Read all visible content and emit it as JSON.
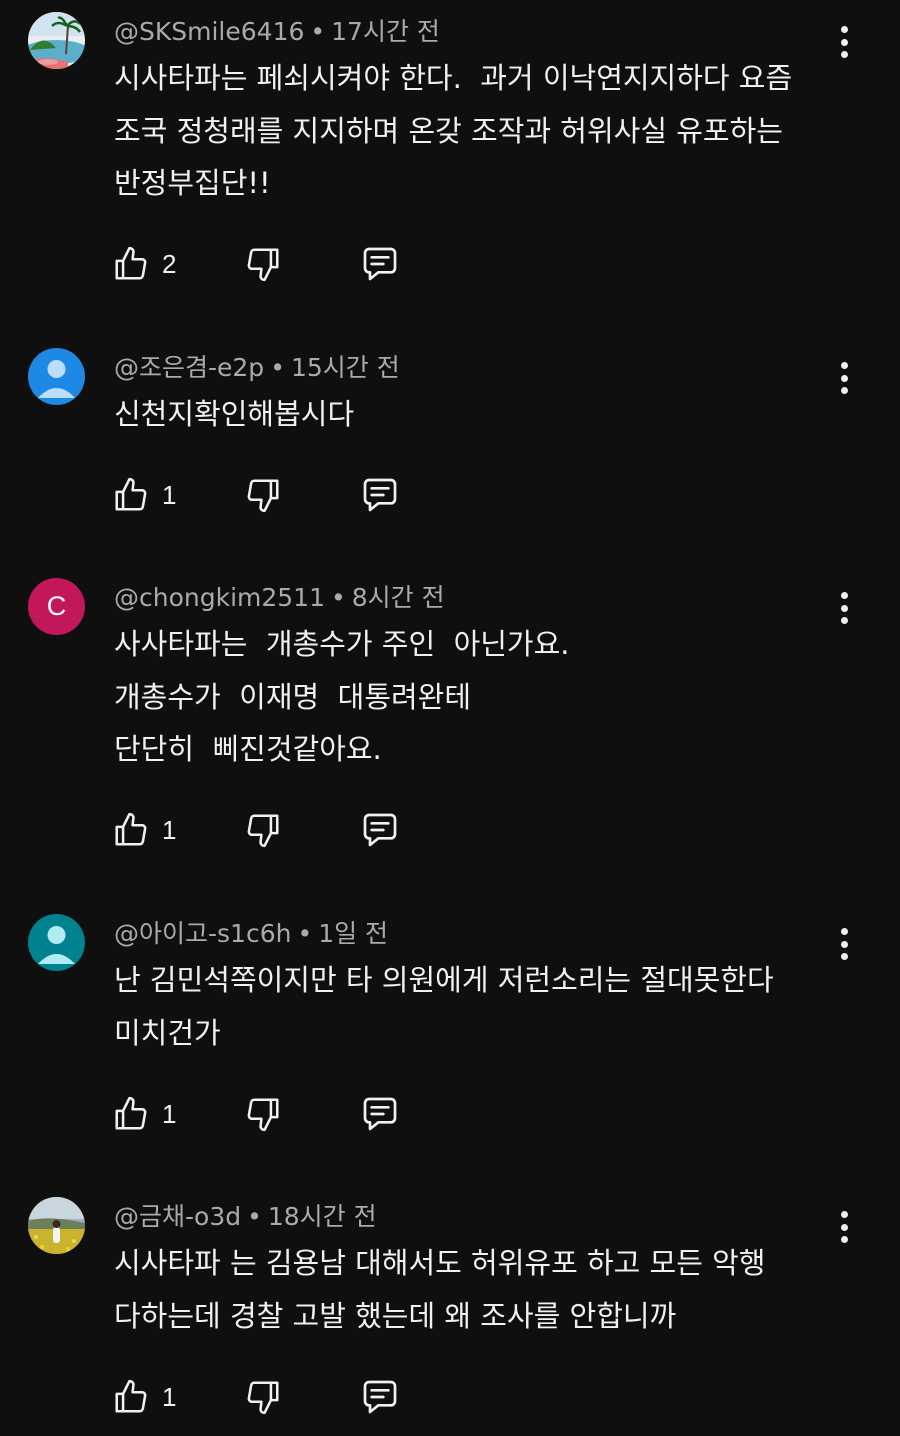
{
  "comments": [
    {
      "handle": "@SKSmile6416",
      "time": "17시간 전",
      "avatar": {
        "type": "image",
        "icon": "beach-palm-tree"
      },
      "lines": [
        "시사타파는 페쇠시켜야 한다.  과거 이낙연지지하다 요즘",
        "조국 정청래를 지지하며 온갖 조작과 허위사실 유포하는",
        "반정부집단!!"
      ],
      "likes": "2"
    },
    {
      "handle": "@조은겸-e2p",
      "time": "15시간 전",
      "avatar": {
        "type": "default-person",
        "color": "#1e88e5"
      },
      "lines": [
        "신천지확인해봅시다"
      ],
      "likes": "1"
    },
    {
      "handle": "@chongkim2511",
      "time": "8시간 전",
      "avatar": {
        "type": "letter",
        "letter": "C",
        "color": "#c2185b"
      },
      "lines": [
        "사사타파는  개총수가 주인  아닌가요.",
        "개총수가  이재명  대통려완테",
        "단단히  삐진것같아요."
      ],
      "likes": "1"
    },
    {
      "handle": "@아이고-s1c6h",
      "time": "1일 전",
      "avatar": {
        "type": "default-person",
        "color": "#00838f"
      },
      "lines": [
        "난 김민석쪽이지만 타 의원에게 저런소리는 절대못한다",
        "미치건가"
      ],
      "likes": "1"
    },
    {
      "handle": "@금채-o3d",
      "time": "18시간 전",
      "avatar": {
        "type": "image",
        "icon": "flower-field-photo"
      },
      "lines": [
        "시사타파 는 김용남 대해서도 허위유포 하고 모든 악행",
        "다하는데 경찰 고발 했는데 왜 조사를 안합니까"
      ],
      "likes": "1"
    }
  ],
  "icons": {
    "like": "thumbs-up-icon",
    "dislike": "thumbs-down-icon",
    "reply": "reply-comment-icon",
    "more": "more-vertical-icon"
  },
  "colors": {
    "background": "#0f0f0f",
    "text": "#f1f1f1",
    "meta": "#aaaaaa"
  }
}
